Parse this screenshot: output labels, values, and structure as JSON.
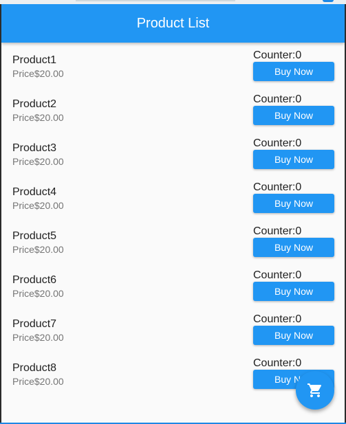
{
  "appbar": {
    "title": "Product List"
  },
  "buy_label": "Buy Now",
  "products": [
    {
      "name": "Product1",
      "price": "Price$20.00",
      "counter": "Counter:0"
    },
    {
      "name": "Product2",
      "price": "Price$20.00",
      "counter": "Counter:0"
    },
    {
      "name": "Product3",
      "price": "Price$20.00",
      "counter": "Counter:0"
    },
    {
      "name": "Product4",
      "price": "Price$20.00",
      "counter": "Counter:0"
    },
    {
      "name": "Product5",
      "price": "Price$20.00",
      "counter": "Counter:0"
    },
    {
      "name": "Product6",
      "price": "Price$20.00",
      "counter": "Counter:0"
    },
    {
      "name": "Product7",
      "price": "Price$20.00",
      "counter": "Counter:0"
    },
    {
      "name": "Product8",
      "price": "Price$20.00",
      "counter": "Counter:0"
    }
  ],
  "fab": {
    "icon": "shopping-cart-icon"
  },
  "colors": {
    "primary": "#2196f3",
    "background": "#fafafa"
  }
}
